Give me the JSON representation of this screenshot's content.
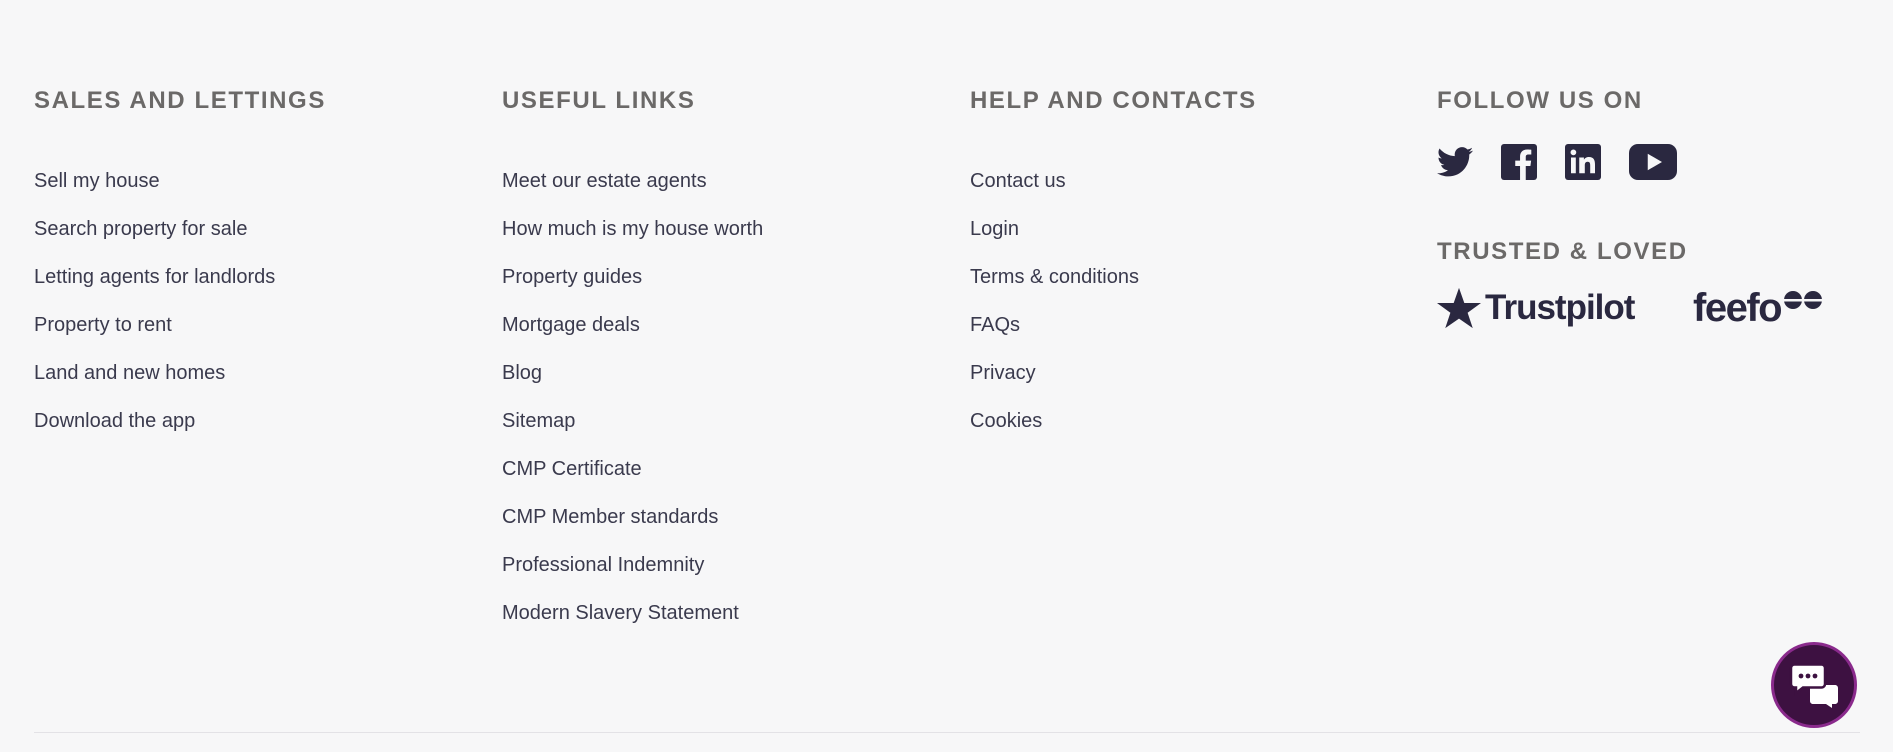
{
  "columns": {
    "sales": {
      "heading": "SALES AND LETTINGS",
      "links": [
        "Sell my house",
        "Search property for sale",
        "Letting agents for landlords",
        "Property to rent",
        "Land and new homes",
        "Download the app"
      ]
    },
    "useful": {
      "heading": "USEFUL LINKS",
      "links": [
        "Meet our estate agents",
        "How much is my house worth",
        "Property guides",
        "Mortgage deals",
        "Blog",
        "Sitemap",
        "CMP Certificate",
        "CMP Member standards",
        "Professional Indemnity",
        "Modern Slavery Statement"
      ]
    },
    "help": {
      "heading": "HELP AND CONTACTS",
      "links": [
        "Contact us",
        "Login",
        "Terms & conditions",
        "FAQs",
        "Privacy",
        "Cookies"
      ]
    },
    "follow": {
      "heading": "FOLLOW US ON",
      "social_icons": [
        "twitter-icon",
        "facebook-icon",
        "linkedin-icon",
        "youtube-icon"
      ],
      "trusted_heading": "TRUSTED & LOVED",
      "trustpilot_label": "Trustpilot",
      "feefo_label": "feefo"
    }
  },
  "colors": {
    "background": "#f7f7f8",
    "text": "#3a3a4d",
    "heading": "#6b6968",
    "icon": "#2a2840",
    "chat_bg": "#3d1141",
    "chat_border": "#8a2a8c"
  },
  "chat": {
    "icon": "chat-bubbles-icon"
  }
}
